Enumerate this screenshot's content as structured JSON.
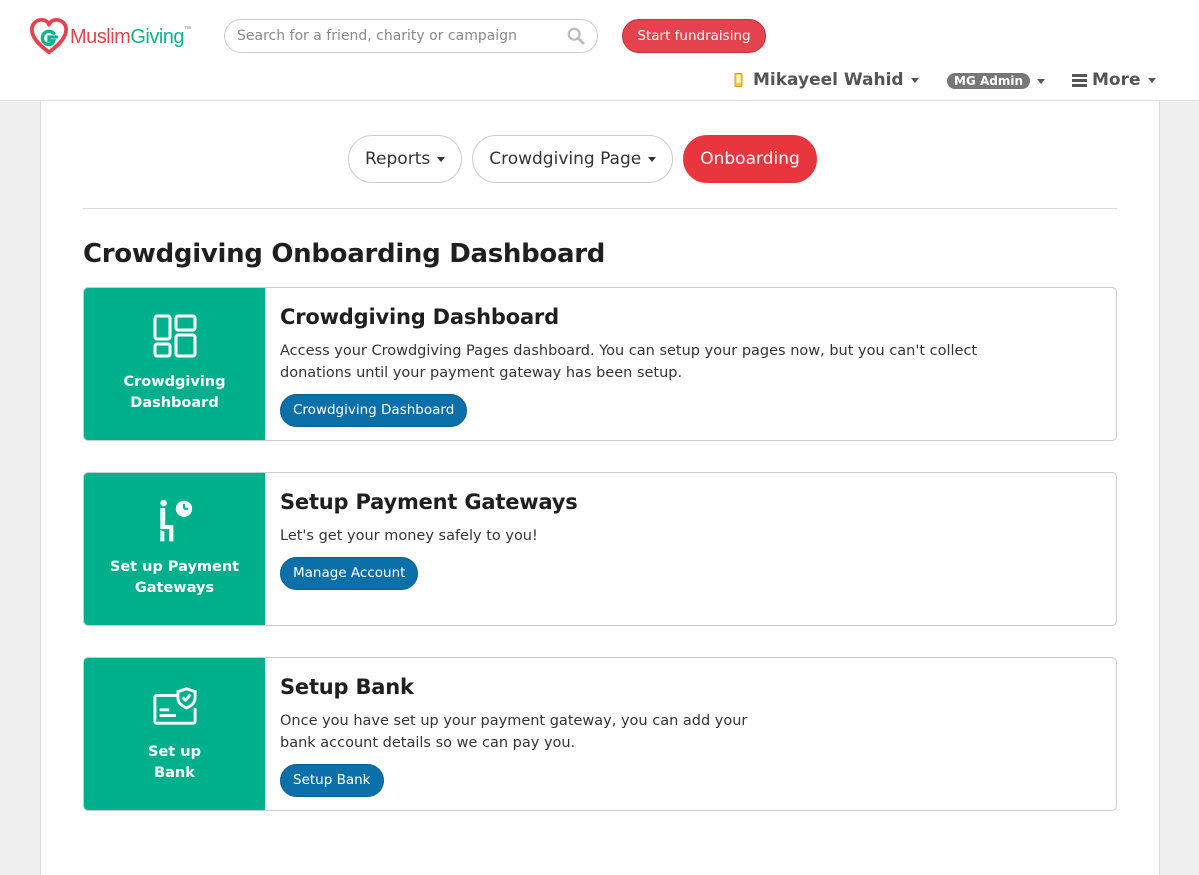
{
  "brand": {
    "name_part1": "Muslim",
    "name_part2": "Giving",
    "trademark": "™"
  },
  "search": {
    "placeholder": "Search for a friend, charity or campaign"
  },
  "header": {
    "start_button": "Start fundraising",
    "user_name": "Mikayeel Wahid",
    "admin_badge": "MG Admin",
    "more_label": "More"
  },
  "tabs": [
    {
      "label": "Reports",
      "has_dropdown": true
    },
    {
      "label": "Crowdgiving Page",
      "has_dropdown": true
    },
    {
      "label": "Onboarding",
      "active": true
    }
  ],
  "page_title": "Crowdgiving Onboarding Dashboard",
  "cards": [
    {
      "side_label_line1": "Crowdgiving",
      "side_label_line2": "Dashboard",
      "icon": "dashboard-icon",
      "title": "Crowdgiving Dashboard",
      "desc_line1": "Access your Crowdgiving Pages dashboard. You can setup your pages now, but you can't collect",
      "desc_line2": "donations until your payment gateway has been setup.",
      "button": "Crowdgiving Dashboard"
    },
    {
      "side_label_line1": "Set up Payment",
      "side_label_line2": "Gateways",
      "icon": "person-clock-icon",
      "title": "Setup Payment Gateways",
      "desc_line1": "Let's get your money safely to you!",
      "desc_line2": "",
      "button": "Manage Account"
    },
    {
      "side_label_line1": "Set up",
      "side_label_line2": "Bank",
      "icon": "bank-card-check-icon",
      "title": "Setup Bank",
      "desc_line1": "Once you have set up your payment gateway, you can add your",
      "desc_line2": "bank account details so we can pay you.",
      "button": "Setup Bank"
    }
  ],
  "colors": {
    "brand_red": "#e4424d",
    "brand_green": "#00b08c",
    "button_blue": "#0b6fa9"
  }
}
